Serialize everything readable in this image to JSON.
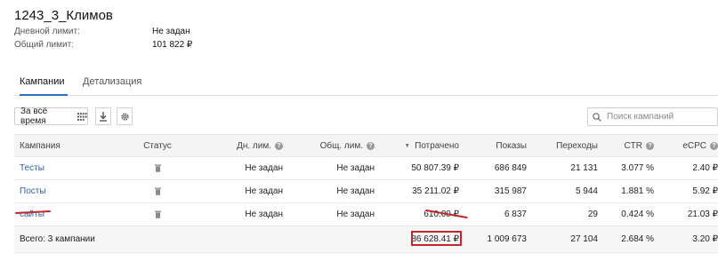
{
  "header": {
    "title": "1243_3_Климов",
    "daily_limit_label": "Дневной лимит:",
    "daily_limit_value": "Не задан",
    "total_limit_label": "Общий лимит:",
    "total_limit_value": "101 822 ₽"
  },
  "tabs": [
    {
      "label": "Кампании",
      "active": true
    },
    {
      "label": "Детализация",
      "active": false
    }
  ],
  "toolbar": {
    "period_label": "За всё время",
    "search_placeholder": "Поиск кампаний"
  },
  "table": {
    "columns": {
      "name": "Кампания",
      "status": "Статус",
      "day_limit": "Дн. лим.",
      "total_limit": "Общ. лим.",
      "spent": "Потрачено",
      "shows": "Показы",
      "clicks": "Переходы",
      "ctr": "CTR",
      "ecpc": "eCPC"
    },
    "rows": [
      {
        "name": "Тесты",
        "day_limit": "Не задан",
        "total_limit": "Не задан",
        "spent": "50 807.39 ₽",
        "shows": "686 849",
        "clicks": "21 131",
        "ctr": "3.077 %",
        "ecpc": "2.40 ₽"
      },
      {
        "name": "Посты",
        "day_limit": "Не задан",
        "total_limit": "Не задан",
        "spent": "35 211.02 ₽",
        "shows": "315 987",
        "clicks": "5 944",
        "ctr": "1.881 %",
        "ecpc": "5.92 ₽"
      },
      {
        "name": "сайты",
        "day_limit": "Не задан",
        "total_limit": "Не задан",
        "spent": "610.00 ₽",
        "shows": "6 837",
        "clicks": "29",
        "ctr": "0.424 %",
        "ecpc": "21.03 ₽"
      }
    ],
    "total": {
      "label": "Всего: 3 кампании",
      "spent": "86 628.41 ₽",
      "shows": "1 009 673",
      "clicks": "27 104",
      "ctr": "2.684 %",
      "ecpc": "3.20 ₽"
    }
  },
  "colors": {
    "link": "#2c5f9e",
    "tab_accent": "#2f6fb7",
    "annotation_red": "#c0262c"
  }
}
